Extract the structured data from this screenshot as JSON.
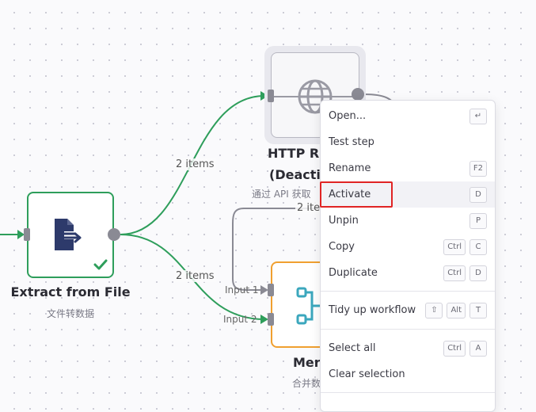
{
  "canvas": {
    "wire_labels": {
      "top": "2 items",
      "bottom": "2 items",
      "merge_in": "2 ite"
    },
    "input_labels": [
      "Input 1",
      "Input 2"
    ]
  },
  "nodes": {
    "extract": {
      "title": "Extract from File",
      "subtitle": "文件转数据"
    },
    "http": {
      "title_line1": "HTTP Re",
      "title_line2": "(Deactiv",
      "subtitle": "通过 API 获取"
    },
    "merge": {
      "title": "Mer",
      "subtitle": "合并数"
    }
  },
  "context_menu": {
    "items": [
      {
        "label": "Open...",
        "keys": [
          "↵"
        ]
      },
      {
        "label": "Test step",
        "keys": []
      },
      {
        "label": "Rename",
        "keys": [
          "F2"
        ]
      },
      {
        "label": "Activate",
        "keys": [
          "D"
        ]
      },
      {
        "label": "Unpin",
        "keys": [
          "P"
        ]
      },
      {
        "label": "Copy",
        "keys": [
          "Ctrl",
          "C"
        ]
      },
      {
        "label": "Duplicate",
        "keys": [
          "Ctrl",
          "D"
        ]
      },
      {
        "label": "Tidy up workflow",
        "keys": [
          "⇧",
          "Alt",
          "T"
        ]
      },
      {
        "label": "Select all",
        "keys": [
          "Ctrl",
          "A"
        ]
      },
      {
        "label": "Clear selection",
        "keys": []
      }
    ]
  },
  "colors": {
    "wire_green": "#2e9e5b",
    "wire_gray": "#8a8a94",
    "extract_border": "#2e9e5b",
    "merge_border": "#f0a030",
    "highlight": "#e02424",
    "file_icon": "#2d3a6b",
    "merge_icon": "#3ba7bd"
  }
}
